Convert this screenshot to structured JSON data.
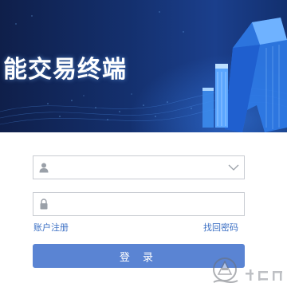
{
  "banner": {
    "title": "能交易终端"
  },
  "login_form": {
    "username_placeholder": "",
    "password_placeholder": "",
    "register_link": "账户注册",
    "recover_link": "找回密码",
    "login_button": "登 录"
  },
  "icons": {
    "user": "user-icon",
    "dropdown": "chevron-down-icon",
    "lock": "lock-icon",
    "watermark": "watermark-logo"
  },
  "colors": {
    "banner_bg": "#14306e",
    "accent": "#5a84d3",
    "link": "#3b6fc4"
  }
}
